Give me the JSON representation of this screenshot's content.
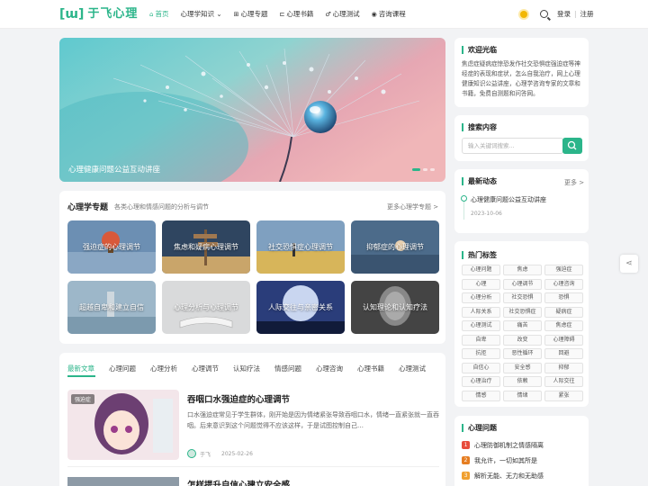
{
  "header": {
    "logo_mark": "[ɯ]",
    "logo_text": "于飞心理",
    "nav": [
      {
        "icon": "⌂",
        "label": "首页"
      },
      {
        "icon": "",
        "label": "心理学知识 ⌄"
      },
      {
        "icon": "⊞",
        "label": "心理专题"
      },
      {
        "icon": "⊏",
        "label": "心理书籍"
      },
      {
        "icon": "♂",
        "label": "心理测试"
      },
      {
        "icon": "◉",
        "label": "咨询课程"
      }
    ],
    "login": "登录",
    "separator": "|",
    "register": "注册"
  },
  "banner": {
    "caption": "心理健康问题公益互动讲座"
  },
  "topics": {
    "title": "心理学专题",
    "subtitle": "各类心理和情感问题的分析与调节",
    "more": "更多心理学专题 >",
    "items": [
      "强迫症的心理调节",
      "焦虑和疑病心理调节",
      "社交恐惧症心理调节",
      "抑郁症的心理调节",
      "超越自卑和建立自信",
      "心理分析与心理调节",
      "人际交往与亲密关系",
      "认知理论和认知疗法"
    ]
  },
  "article_tabs": [
    "最新文章",
    "心理问题",
    "心理分析",
    "心理调节",
    "认知疗法",
    "情感问题",
    "心理咨询",
    "心理书籍",
    "心理测试"
  ],
  "articles": [
    {
      "badge": "强迫症",
      "title": "吞咽口水强迫症的心理调节",
      "excerpt": "口水强迫症常见于学生群体，刚开始是因为情绪紧张导致吞咽口水，情绪一直紧张就一直吞咽。后来意识到这个问题觉得不应该这样，于是试图控制自己…",
      "author": "于飞",
      "date": "2025-02-26"
    },
    {
      "badge": "",
      "title": "怎样提升自信心建立安全感",
      "excerpt": "",
      "author": "",
      "date": ""
    }
  ],
  "sidebar": {
    "welcome": {
      "title": "欢迎光临",
      "text": "焦虑症疑病症惊恐发作社交恐惧症强迫症等神经症的表现和症状，怎么自我治疗，网上心理健康知识公益讲座，心理学咨询专家的文章和书籍，免费自测题和问答网。"
    },
    "search": {
      "title": "搜索内容",
      "placeholder": "输入关键词搜索..."
    },
    "news": {
      "title": "最新动态",
      "more": "更多 >",
      "items": [
        {
          "title": "心理健康问题公益互动讲座",
          "date": "2023-10-06"
        }
      ]
    },
    "tags": {
      "title": "热门标签",
      "items": [
        "心理问题",
        "焦虑",
        "强迫症",
        "心理",
        "心理调节",
        "心理咨询",
        "心理分析",
        "社交恐惧",
        "恐惧",
        "人际关系",
        "社交恐惧症",
        "疑病症",
        "心理测试",
        "痛苦",
        "焦虑症",
        "自卑",
        "改变",
        "心理障碍",
        "抗拒",
        "恶性循环",
        "回避",
        "自信心",
        "安全感",
        "抑郁",
        "心理治疗",
        "依赖",
        "人际交往",
        "情感",
        "情绪",
        "紧张"
      ]
    },
    "problems": {
      "title": "心理问题",
      "items": [
        {
          "num": "1",
          "text": "心理防御机制之情感隔离",
          "color": "#e74c3c"
        },
        {
          "num": "2",
          "text": "我允许，一切如其所是",
          "color": "#e67e22"
        },
        {
          "num": "3",
          "text": "解析无能、无力和无助感",
          "color": "#f0a030"
        }
      ]
    }
  },
  "colors": {
    "accent": "#2bb58a"
  }
}
